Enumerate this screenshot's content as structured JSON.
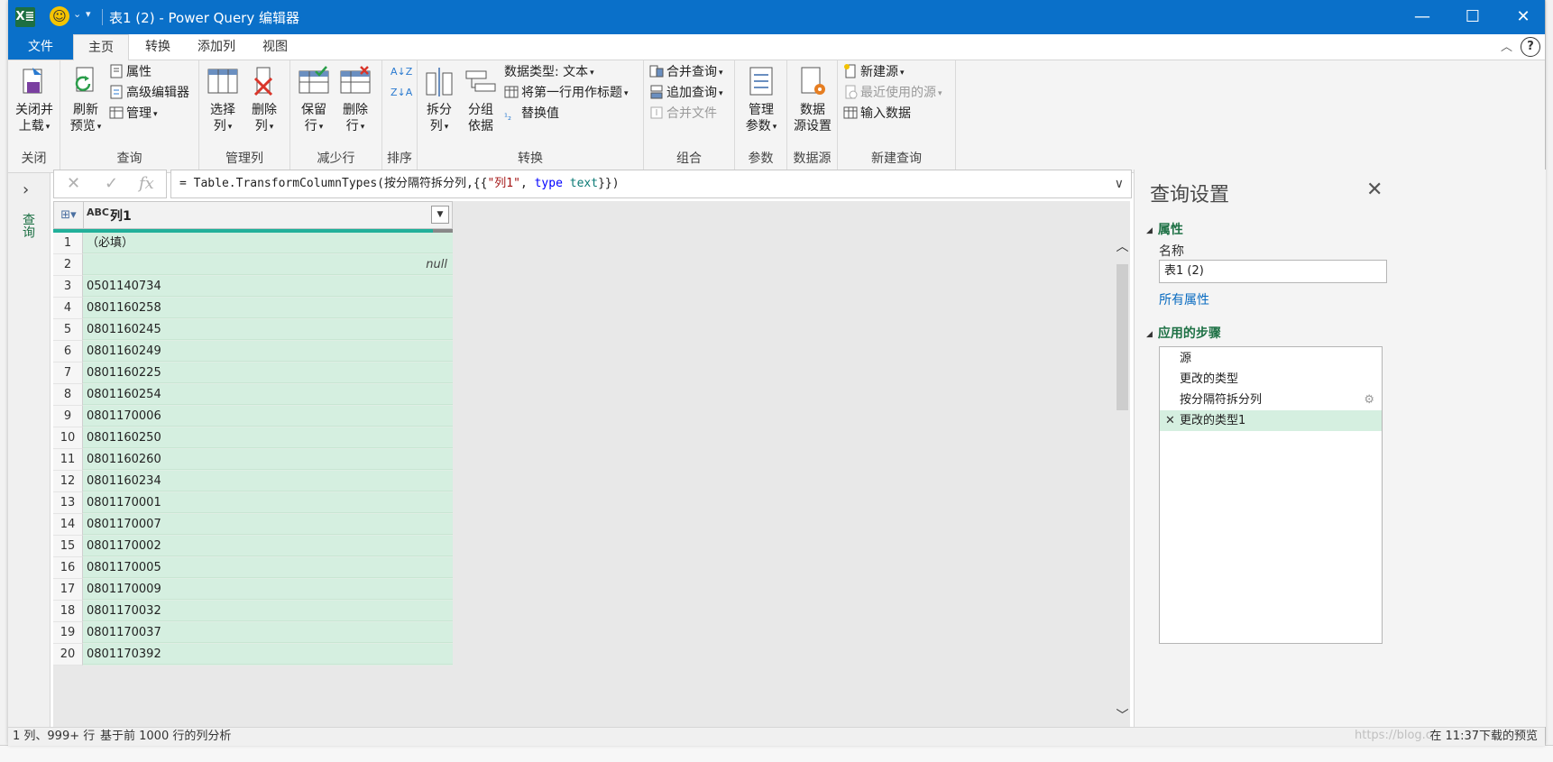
{
  "titlebar": {
    "app_icon": "X≣",
    "title": "表1 (2) - Power Query 编辑器"
  },
  "tabs": [
    {
      "label": "文件"
    },
    {
      "label": "主页"
    },
    {
      "label": "转换"
    },
    {
      "label": "添加列"
    },
    {
      "label": "视图"
    }
  ],
  "ribbon": {
    "close_group": {
      "btn": "关闭并",
      "btn2": "上载",
      "label": "关闭"
    },
    "query_group": {
      "refresh": "刷新",
      "refresh2": "预览",
      "properties": "属性",
      "advanced_editor": "高级编辑器",
      "manage": "管理",
      "label": "查询"
    },
    "columns_group": {
      "choose": "选择",
      "choose2": "列",
      "remove": "删除",
      "remove2": "列",
      "label": "管理列"
    },
    "rows_group": {
      "keep": "保留",
      "keep2": "行",
      "remove": "删除",
      "remove2": "行",
      "label": "减少行"
    },
    "sort_group": {
      "label": "排序"
    },
    "transform_group": {
      "split": "拆分",
      "split2": "列",
      "group": "分组",
      "group2": "依据",
      "datatype": "数据类型: 文本",
      "first_row": "将第一行用作标题",
      "replace": "替换值",
      "label": "转换"
    },
    "combine_group": {
      "merge": "合并查询",
      "append": "追加查询",
      "combine_files": "合并文件",
      "label": "组合"
    },
    "params_group": {
      "manage": "管理",
      "manage2": "参数",
      "label": "参数"
    },
    "datasource_group": {
      "settings": "数据",
      "settings2": "源设置",
      "label": "数据源"
    },
    "newquery_group": {
      "new_source": "新建源",
      "recent": "最近使用的源",
      "enter": "输入数据",
      "label": "新建查询"
    }
  },
  "leftpane": {
    "label": "查询"
  },
  "formula": {
    "prefix": "= Table.TransformColumnTypes(按分隔符拆分列,{{",
    "str": "\"列1\"",
    "mid": ", ",
    "kw": "type",
    "sp": " ",
    "kw2": "text",
    "suffix": "}})"
  },
  "grid": {
    "type_icon": "ABC",
    "column": "列1",
    "rows": [
      {
        "n": "1",
        "v": "（必填）"
      },
      {
        "n": "2",
        "v": "null"
      },
      {
        "n": "3",
        "v": "0501140734"
      },
      {
        "n": "4",
        "v": "0801160258"
      },
      {
        "n": "5",
        "v": "0801160245"
      },
      {
        "n": "6",
        "v": "0801160249"
      },
      {
        "n": "7",
        "v": "0801160225"
      },
      {
        "n": "8",
        "v": "0801160254"
      },
      {
        "n": "9",
        "v": "0801170006"
      },
      {
        "n": "10",
        "v": "0801160250"
      },
      {
        "n": "11",
        "v": "0801160260"
      },
      {
        "n": "12",
        "v": "0801160234"
      },
      {
        "n": "13",
        "v": "0801170001"
      },
      {
        "n": "14",
        "v": "0801170007"
      },
      {
        "n": "15",
        "v": "0801170002"
      },
      {
        "n": "16",
        "v": "0801170005"
      },
      {
        "n": "17",
        "v": "0801170009"
      },
      {
        "n": "18",
        "v": "0801170032"
      },
      {
        "n": "19",
        "v": "0801170037"
      },
      {
        "n": "20",
        "v": "0801170392"
      }
    ]
  },
  "settings": {
    "title": "查询设置",
    "properties_section": "属性",
    "name_label": "名称",
    "name_value": "表1 (2)",
    "all_properties": "所有属性",
    "steps_section": "应用的步骤",
    "steps": [
      "源",
      "更改的类型",
      "按分隔符拆分列",
      "更改的类型1"
    ]
  },
  "status": {
    "left": "1 列、999+ 行",
    "profile": "基于前 1000 行的列分析",
    "right": "在 11:37下载的预览",
    "watermark": "https://blog.c"
  },
  "colors": {
    "titlebar": "#0a70c9",
    "accent_green": "#1e7145",
    "cell_fill": "#d5efe0",
    "quality_bar": "#22b09a"
  }
}
